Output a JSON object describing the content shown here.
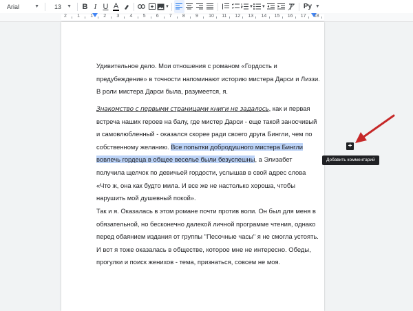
{
  "toolbar": {
    "font_family": "Arial",
    "font_size": "13",
    "bold": "B",
    "italic": "I",
    "underline": "U",
    "text_color": "A",
    "language": "Ру"
  },
  "ruler": {
    "numbers": [
      "2",
      "1",
      "1",
      "2",
      "3",
      "4",
      "5",
      "6",
      "7",
      "8",
      "9",
      "10",
      "11",
      "12",
      "13",
      "14",
      "15",
      "16",
      "17",
      "18"
    ]
  },
  "document": {
    "para1": [
      "Удивительное дело. Мои отношения с романом «Гордость и",
      "предубеждение» в точности напоминают историю мистера Дарси и Лиззи.",
      "В роли мистера Дарси была, разумеется, я."
    ],
    "para2_link": "Знакомство с первыми страницами книги не задалось",
    "para2_line1_rest": ", как и первая",
    "para2_lines_a": [
      "встреча наших героев на балу, где мистер Дарси - еще такой заносчивый",
      "и самовлюбленный - оказался скорее ради своего друга Бингли, чем по"
    ],
    "para2_line4_before": "собственному желанию. ",
    "para2_selection_line4": "Все попытки добродушного мистера Бингли",
    "para2_selection_line5": "вовлечь гордеца в общее веселье были безуспешны",
    "para2_line5_rest": ", а Элизабет",
    "para2_lines_b": [
      "получила щелчок по девичьей гордости, услышав в свой адрес слова",
      "«Что ж, она как будто мила. И все же не настолько хороша, чтобы",
      "нарушить мой душевный покой»."
    ],
    "para3": [
      "Так и я. Оказалась в этом романе почти против воли. Он был для меня в",
      "обязательной, но бесконечно далекой личной программе чтения, однако",
      "перед обаянием издания от группы \"Песочные часы\" я не смогла устоять.",
      "И вот я тоже оказалась в обществе, которое мне не интересно. Обеды,",
      "прогулки и поиск женихов - тема, признаться, совсем не моя."
    ]
  },
  "comment": {
    "icon": "add-comment-icon",
    "tooltip": "Добавить комментарий"
  },
  "colors": {
    "selection": "#bcd3f7",
    "arrow": "#c62828",
    "accent": "#4285f4"
  }
}
